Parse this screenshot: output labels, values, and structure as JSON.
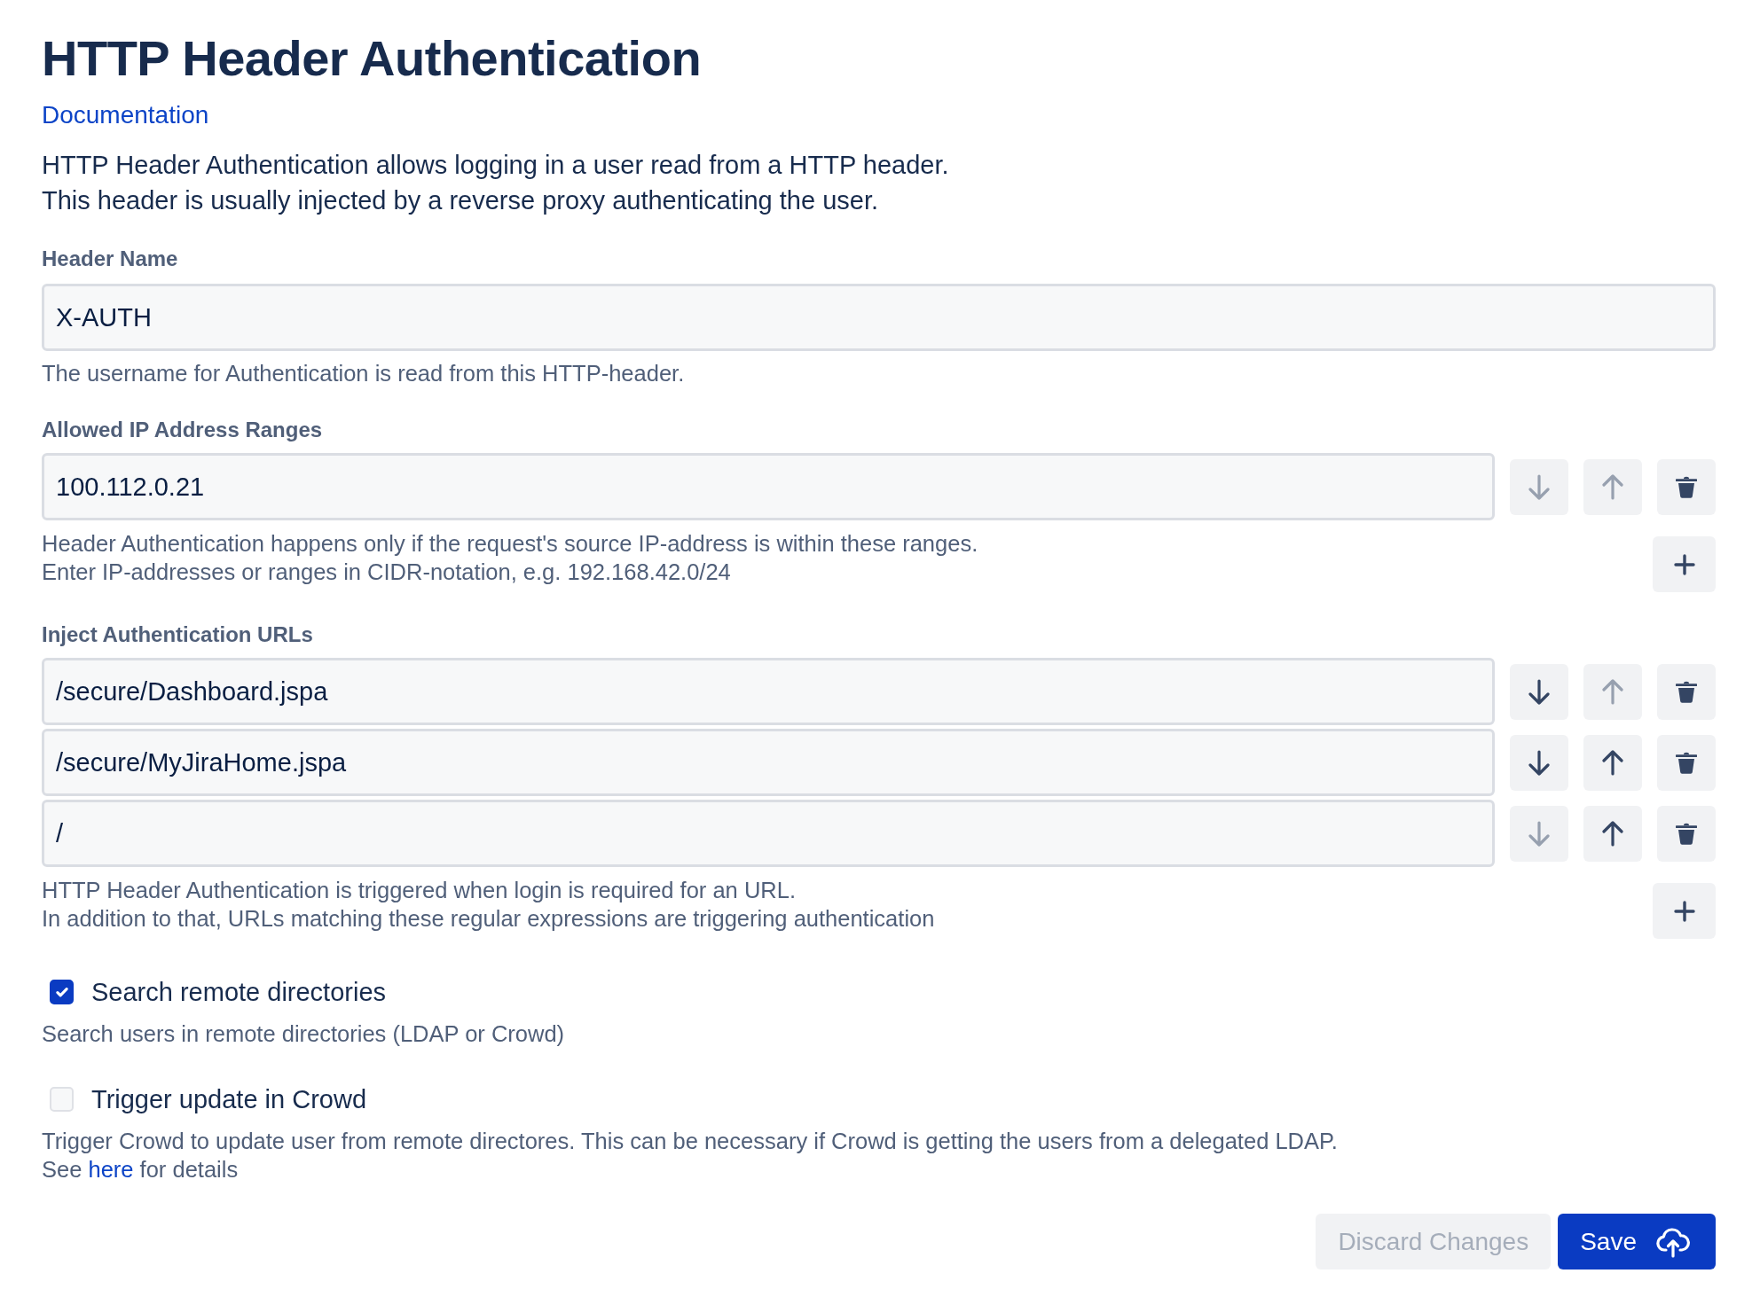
{
  "title": "HTTP Header Authentication",
  "documentation_link": "Documentation",
  "description": [
    "HTTP Header Authentication allows logging in a user read from a HTTP header.",
    "This header is usually injected by a reverse proxy authenticating the user."
  ],
  "header_name": {
    "label": "Header Name",
    "value": "X-AUTH",
    "help": [
      "The username for Authentication is read from this HTTP-header."
    ]
  },
  "allowed_ip_ranges": {
    "label": "Allowed IP Address Ranges",
    "entries": [
      {
        "value": "100.112.0.21",
        "down_disabled": true,
        "up_disabled": true
      }
    ],
    "help": [
      "Header Authentication happens only if the request's source IP-address is within these ranges.",
      "Enter IP-addresses or ranges in CIDR-notation, e.g. 192.168.42.0/24"
    ]
  },
  "inject_urls": {
    "label": "Inject Authentication URLs",
    "entries": [
      {
        "value": "/secure/Dashboard.jspa",
        "down_disabled": false,
        "up_disabled": true
      },
      {
        "value": "/secure/MyJiraHome.jspa",
        "down_disabled": false,
        "up_disabled": false
      },
      {
        "value": "/",
        "down_disabled": true,
        "up_disabled": false
      }
    ],
    "help": [
      "HTTP Header Authentication is triggered when login is required for an URL.",
      "In addition to that, URLs matching these regular expressions are triggering authentication"
    ]
  },
  "options": [
    {
      "label": "Search remote directories",
      "checked": true,
      "help": [
        "Search users in remote directories (LDAP or Crowd)"
      ]
    },
    {
      "label": "Trigger update in Crowd",
      "checked": false,
      "help": [
        "Trigger Crowd to update user from remote directores. This can be necessary if Crowd is getting the users from a delegated LDAP."
      ],
      "help_link": {
        "before": "See",
        "link": "here",
        "after": "for details"
      }
    }
  ],
  "buttons": [
    {
      "label": "Discard Changes",
      "kind": "secondary",
      "disabled": true
    },
    {
      "label": "Save",
      "kind": "primary",
      "disabled": false
    }
  ]
}
